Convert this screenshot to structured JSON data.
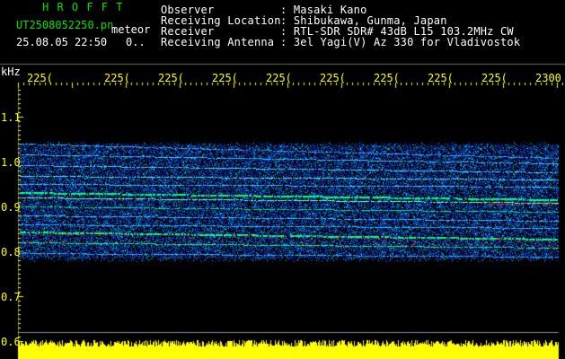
{
  "header": {
    "brand": "H R O F F T",
    "filename": "UT2508052250.pn",
    "mode": "meteor",
    "datetime": "25.08.05 22:50",
    "value": "0..",
    "info": [
      {
        "label": "Observer",
        "value": ": Masaki Kano"
      },
      {
        "label": "Receiving Location",
        "value": ": Shibukawa, Gunma, Japan"
      },
      {
        "label": "Receiver",
        "value": ": RTL-SDR SDR# 43dB L15 103.2MHz CW"
      },
      {
        "label": "Receiving Antenna",
        "value": ": 3el Yagi(V) Az 330 for Vladivostok"
      }
    ]
  },
  "axes": {
    "y_unit": "kHz",
    "y_ticks": [
      "1.1",
      "1.0",
      "0.9",
      "0.8",
      "0.7",
      "0.6"
    ],
    "x_ticks": [
      "225(",
      "225(",
      "225(",
      "225(",
      "225(",
      "225(",
      "225(",
      "225(",
      "225(",
      "2300"
    ]
  },
  "colors": {
    "background": "#000000",
    "text_white": "#ffffff",
    "text_green": "#00e400",
    "tick_yellow": "#ffff00",
    "signal_low": "#0a1ea0",
    "signal_mid": "#00c8ff",
    "signal_high": "#00ff80",
    "signal_peak": "#ff2020"
  }
}
